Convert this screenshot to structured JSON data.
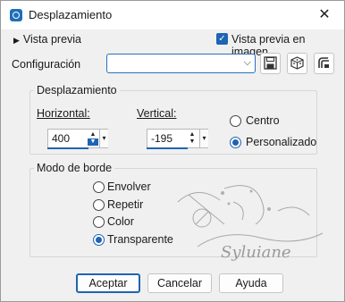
{
  "window": {
    "title": "Desplazamiento",
    "close_glyph": "✕"
  },
  "preview": {
    "toggle_label": "Vista previa",
    "checkbox_label": "Vista previa en imagen",
    "checked": true
  },
  "config": {
    "label": "Configuración",
    "value": ""
  },
  "offset": {
    "title": "Desplazamiento",
    "horizontal_label": "Horizontal:",
    "horizontal_value": "400",
    "vertical_label": "Vertical:",
    "vertical_value": "-195",
    "centro_label": "Centro",
    "personalizado_label": "Personalizado",
    "selected": "Personalizado"
  },
  "edge": {
    "title": "Modo de borde",
    "options": [
      "Envolver",
      "Repetir",
      "Color",
      "Transparente"
    ],
    "selected": "Transparente"
  },
  "watermark_text": "Syluiane",
  "buttons": {
    "accept": "Aceptar",
    "cancel": "Cancelar",
    "help": "Ayuda"
  },
  "colors": {
    "accent": "#1e64b4"
  }
}
